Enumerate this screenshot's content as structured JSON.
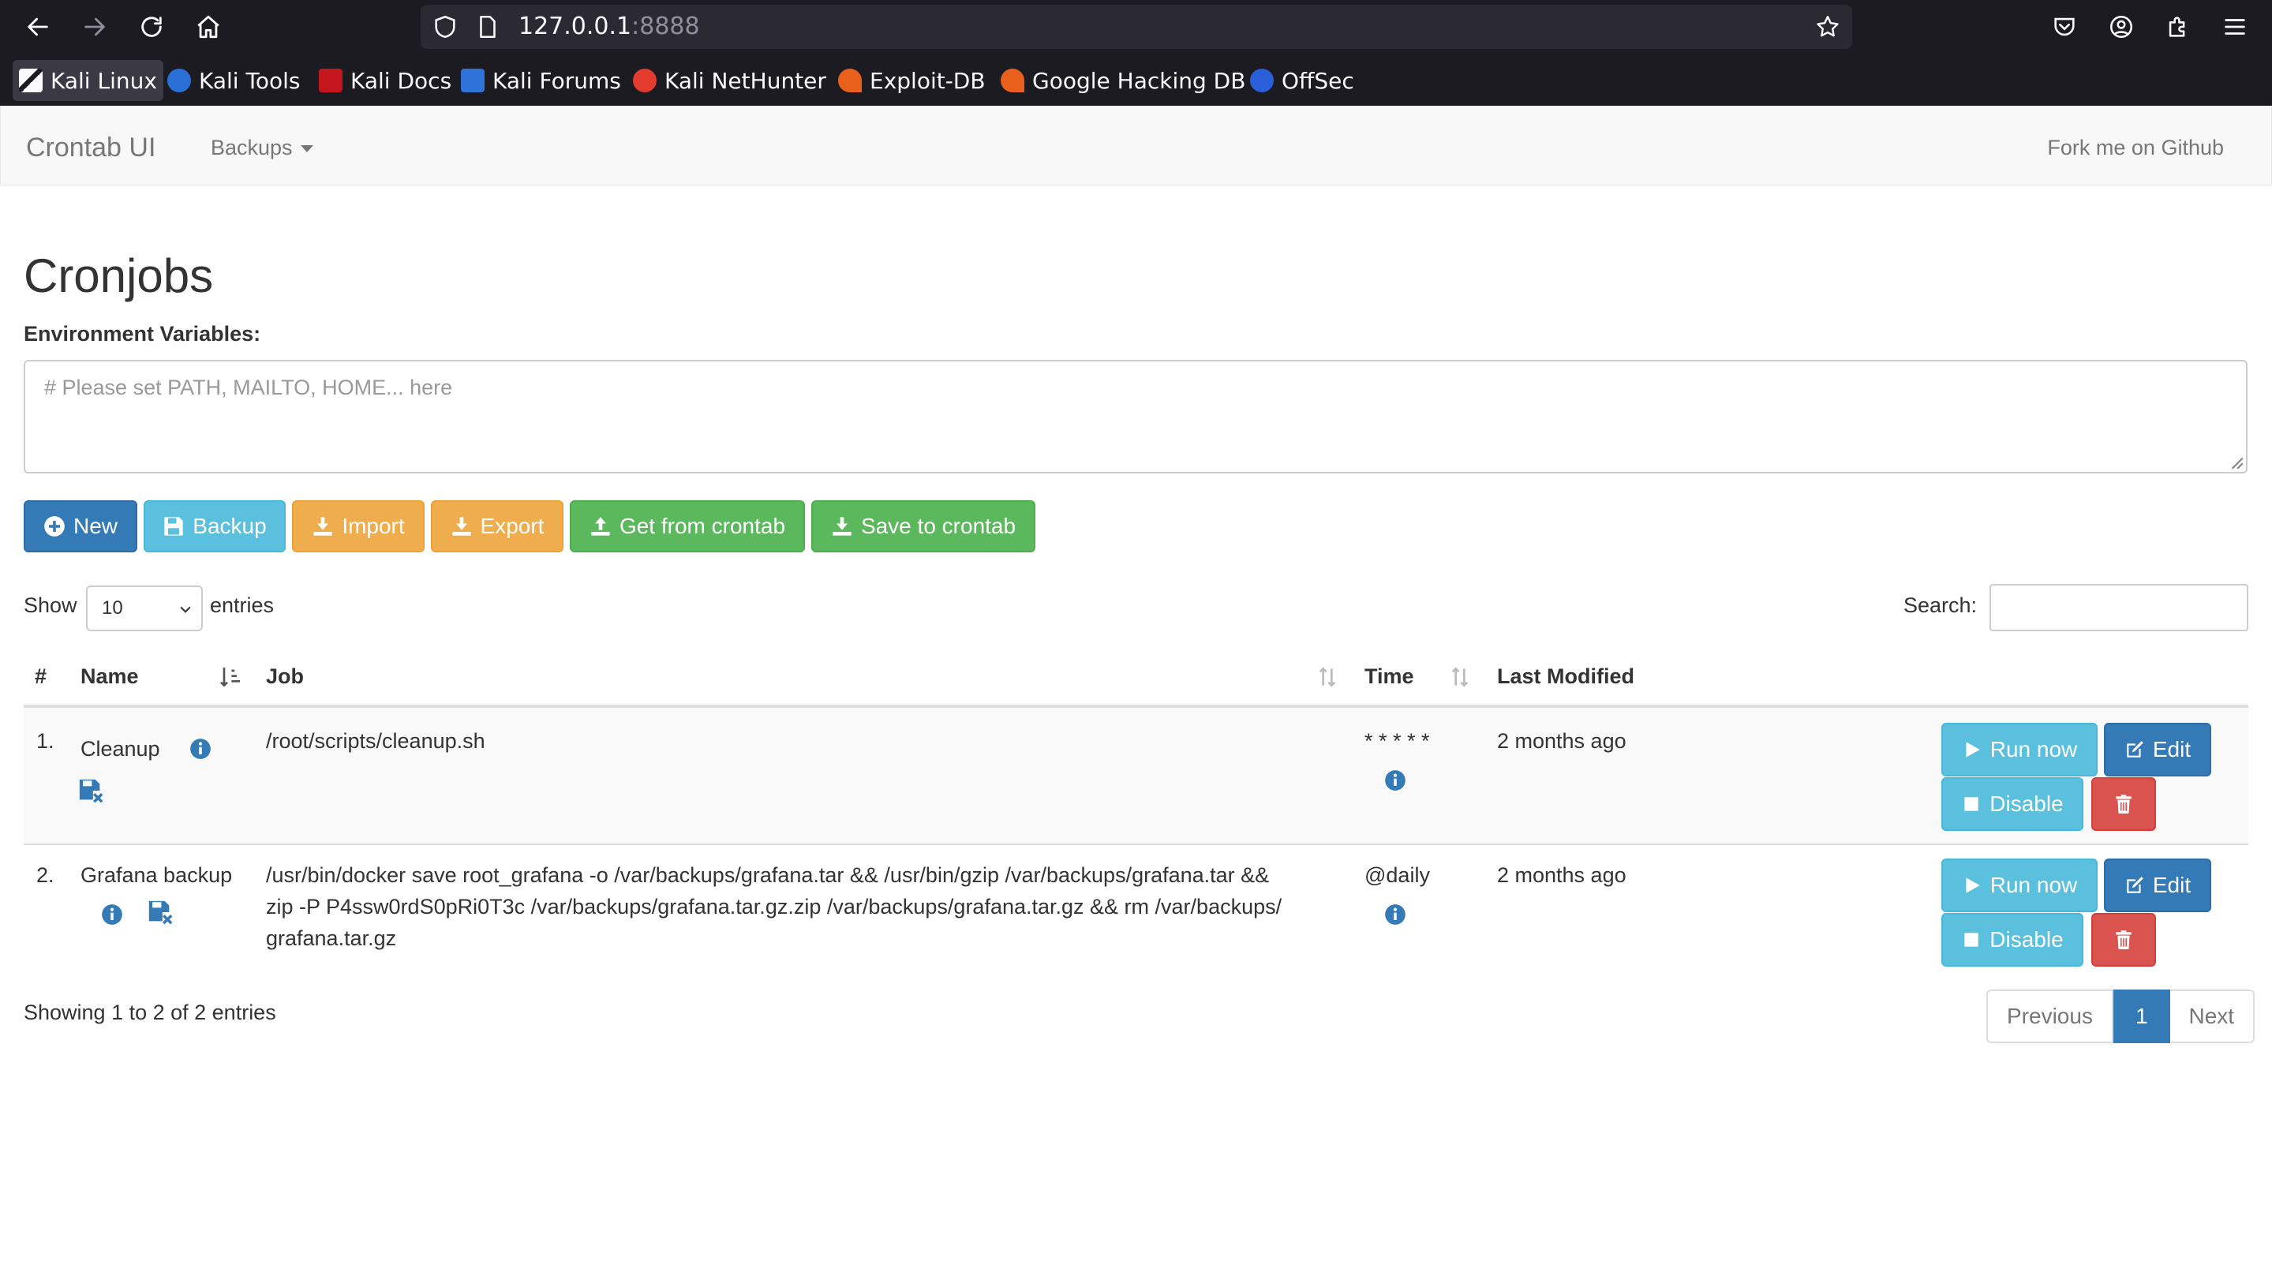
{
  "browser": {
    "url_host": "127.0.0.1",
    "url_port": ":8888",
    "bookmarks": [
      {
        "label": "Kali Linux",
        "color": "#1e74d6"
      },
      {
        "label": "Kali Tools",
        "color": "#2a6fd6"
      },
      {
        "label": "Kali Docs",
        "color": "#c4161c"
      },
      {
        "label": "Kali Forums",
        "color": "#2f73d8"
      },
      {
        "label": "Kali NetHunter",
        "color": "#e33b2e"
      },
      {
        "label": "Exploit-DB",
        "color": "#e8601c"
      },
      {
        "label": "Google Hacking DB",
        "color": "#e8601c"
      },
      {
        "label": "OffSec",
        "color": "#2b5fd9"
      }
    ]
  },
  "navbar": {
    "brand": "Crontab UI",
    "backups_label": "Backups",
    "fork_label": "Fork me on Github"
  },
  "page": {
    "title": "Cronjobs",
    "env_label": "Environment Variables:",
    "env_placeholder": "# Please set PATH, MAILTO, HOME... here"
  },
  "toolbar": {
    "new_label": "New",
    "backup_label": "Backup",
    "import_label": "Import",
    "export_label": "Export",
    "get_label": "Get from crontab",
    "save_label": "Save to crontab"
  },
  "table_controls": {
    "show_label": "Show",
    "entries_value": "10",
    "entries_label": "entries",
    "search_label": "Search:"
  },
  "table": {
    "columns": [
      "#",
      "Name",
      "Job",
      "Time",
      "Last Modified"
    ],
    "rows": [
      {
        "index": "1.",
        "name": "Cleanup",
        "job_lines": [
          "/root/scripts/cleanup.sh"
        ],
        "time": "* * * * *",
        "modified": "2 months ago"
      },
      {
        "index": "2.",
        "name": "Grafana backup",
        "job_lines": [
          "/usr/bin/docker save root_grafana -o /var/backups/grafana.tar && /usr/bin/gzip /var/backups/grafana.tar &&",
          "zip -P P4ssw0rdS0pRi0T3c /var/backups/grafana.tar.gz.zip /var/backups/grafana.tar.gz && rm /var/backups/",
          "grafana.tar.gz"
        ],
        "time": "@daily",
        "modified": "2 months ago"
      }
    ],
    "actions": {
      "run_label": "Run now",
      "edit_label": "Edit",
      "disable_label": "Disable"
    }
  },
  "footer": {
    "showing": "Showing 1 to 2 of 2 entries",
    "prev": "Previous",
    "page": "1",
    "next": "Next"
  }
}
